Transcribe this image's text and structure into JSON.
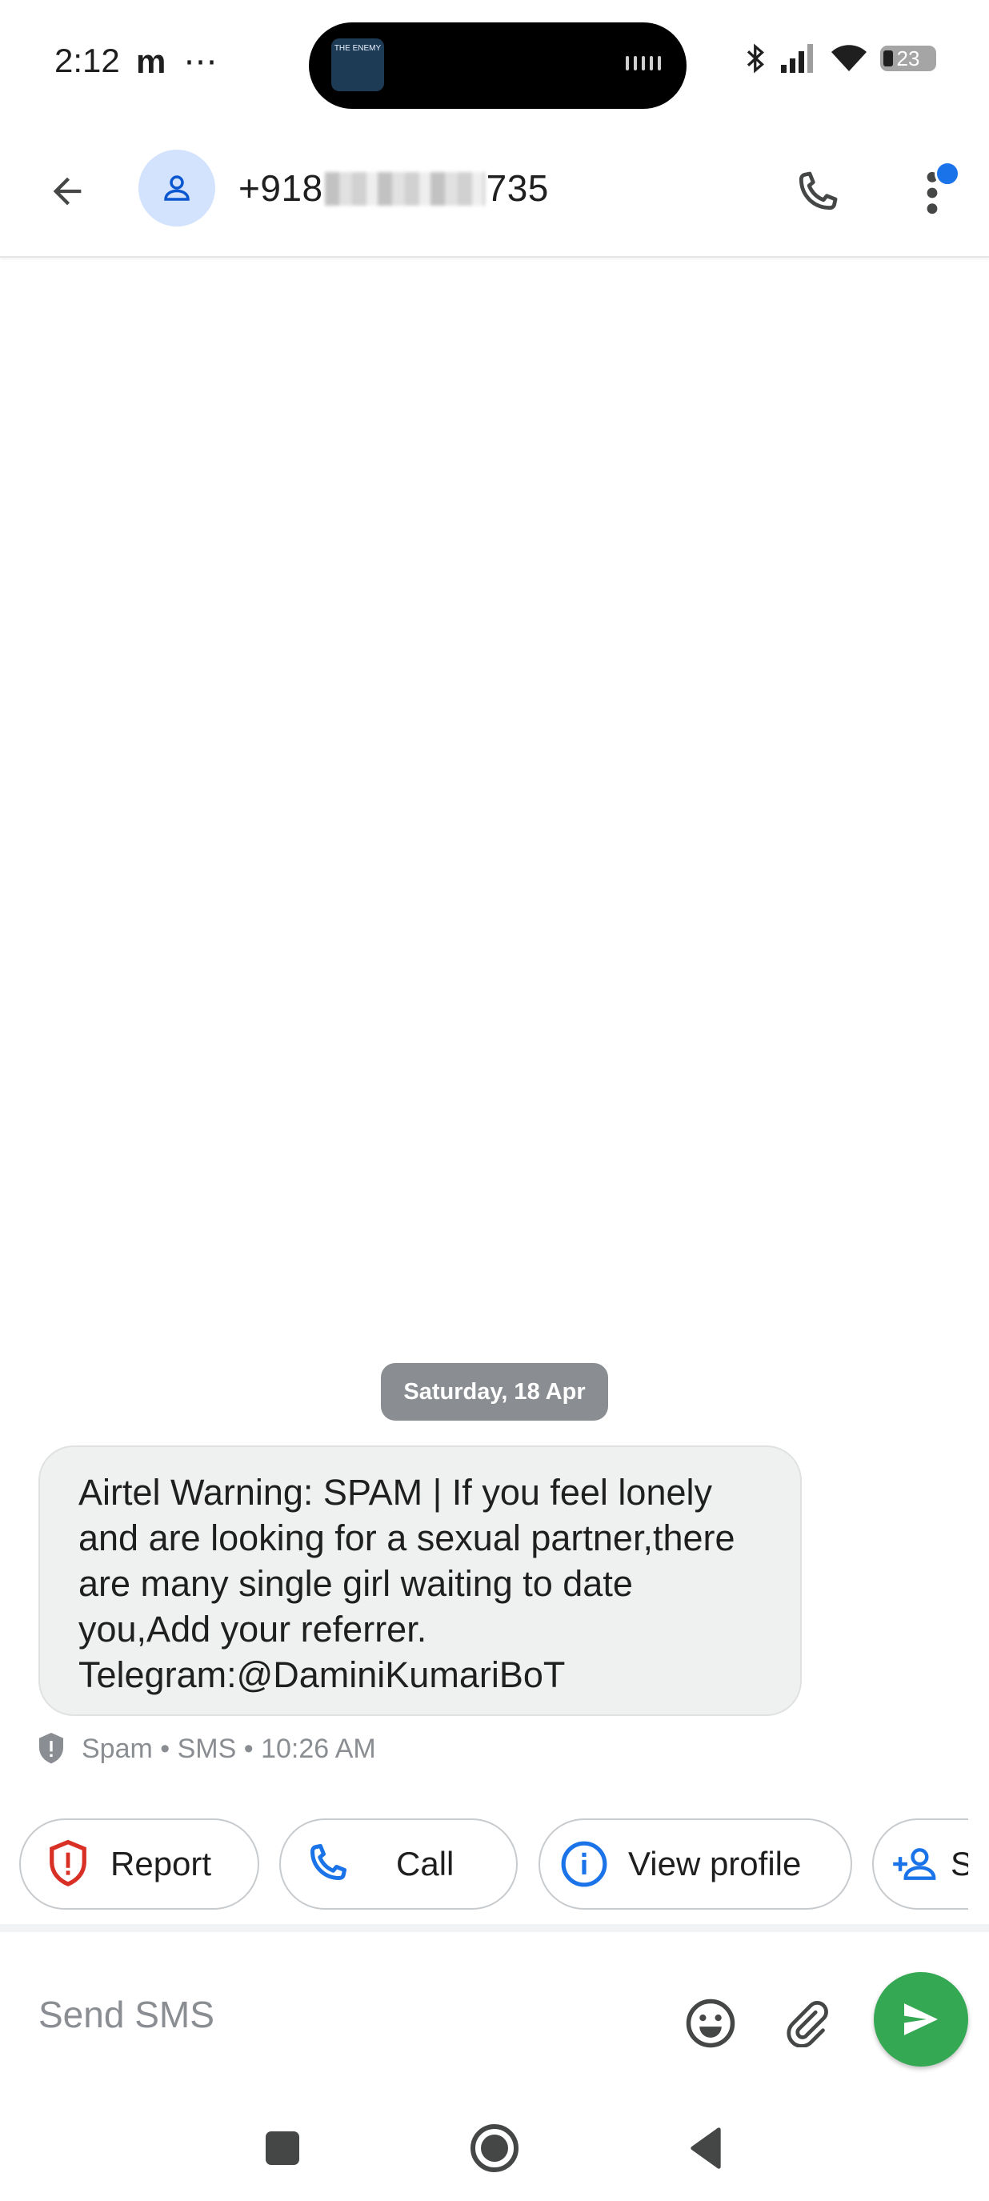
{
  "status_bar": {
    "time": "2:12",
    "left_icons": [
      "m",
      "⋯"
    ],
    "island_thumb_text": "THE ENEMY",
    "battery": "23"
  },
  "header": {
    "number_prefix": "+918",
    "number_suffix": "735"
  },
  "conversation": {
    "date": "Saturday, 18 Apr",
    "message": "Airtel Warning: SPAM | If you feel lonely and are looking for a sexual partner,there are many single girl waiting to date you,Add your referrer. Telegram:@DaminiKumariBoT",
    "meta": "Spam • SMS • 10:26 AM"
  },
  "chips": {
    "report": "Report",
    "call": "Call",
    "view_profile": "View profile",
    "add_contact": "S"
  },
  "compose": {
    "placeholder": "Send SMS"
  },
  "colors": {
    "accent": "#1a73e8",
    "send": "#34a853",
    "report": "#d93025",
    "bubble": "#eff1f0",
    "date_chip": "#8a8d91"
  }
}
